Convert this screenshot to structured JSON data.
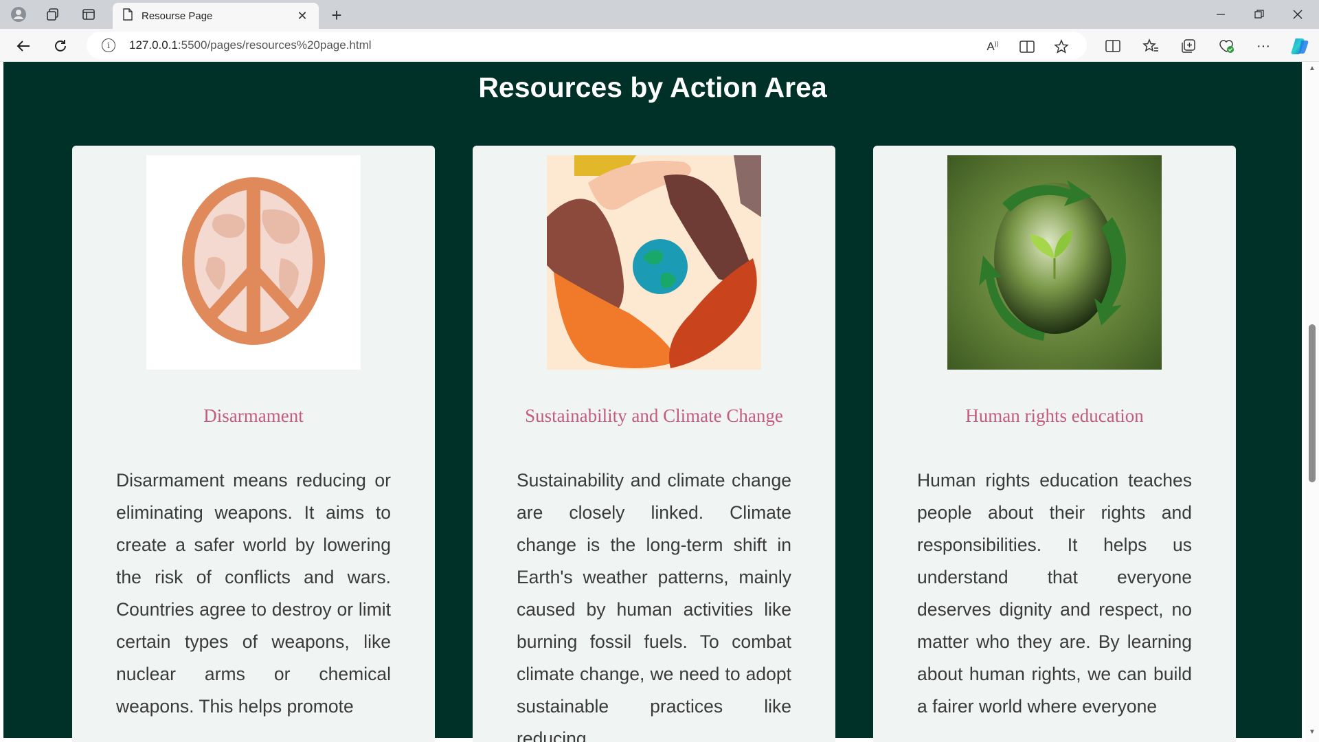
{
  "browser": {
    "tab_title": "Resourse Page",
    "url_host": "127.0.0.1",
    "url_path": ":5500/pages/resources%20page.html"
  },
  "page": {
    "heading": "Resources by Action Area",
    "cards": [
      {
        "title": "Disarmament",
        "image_icon": "peace-symbol-globe",
        "text": "Disarmament means reducing or eliminating weapons. It aims to create a safer world by lowering the risk of conflicts and wars. Countries agree to destroy or limit certain types of weapons, like nuclear arms or chemical weapons. This helps promote"
      },
      {
        "title": "Sustainability and Climate Change",
        "image_icon": "hands-around-earth",
        "text": "Sustainability and climate change are closely linked. Climate change is the long-term shift in Earth's weather patterns, mainly caused by human activities like burning fossil fuels. To combat climate change, we need to adopt sustainable practices like reducing"
      },
      {
        "title": "Human rights education",
        "image_icon": "recycling-green-earth",
        "text": "Human rights education teaches people about their rights and responsibilities. It helps us understand that everyone deserves dignity and respect, no matter who they are. By learning about human rights, we can build a fairer world where everyone"
      }
    ]
  },
  "colors": {
    "page_background": "#003129",
    "card_background": "#f0f4f2",
    "card_title": "#c45c7e",
    "heading": "#ffffff"
  }
}
